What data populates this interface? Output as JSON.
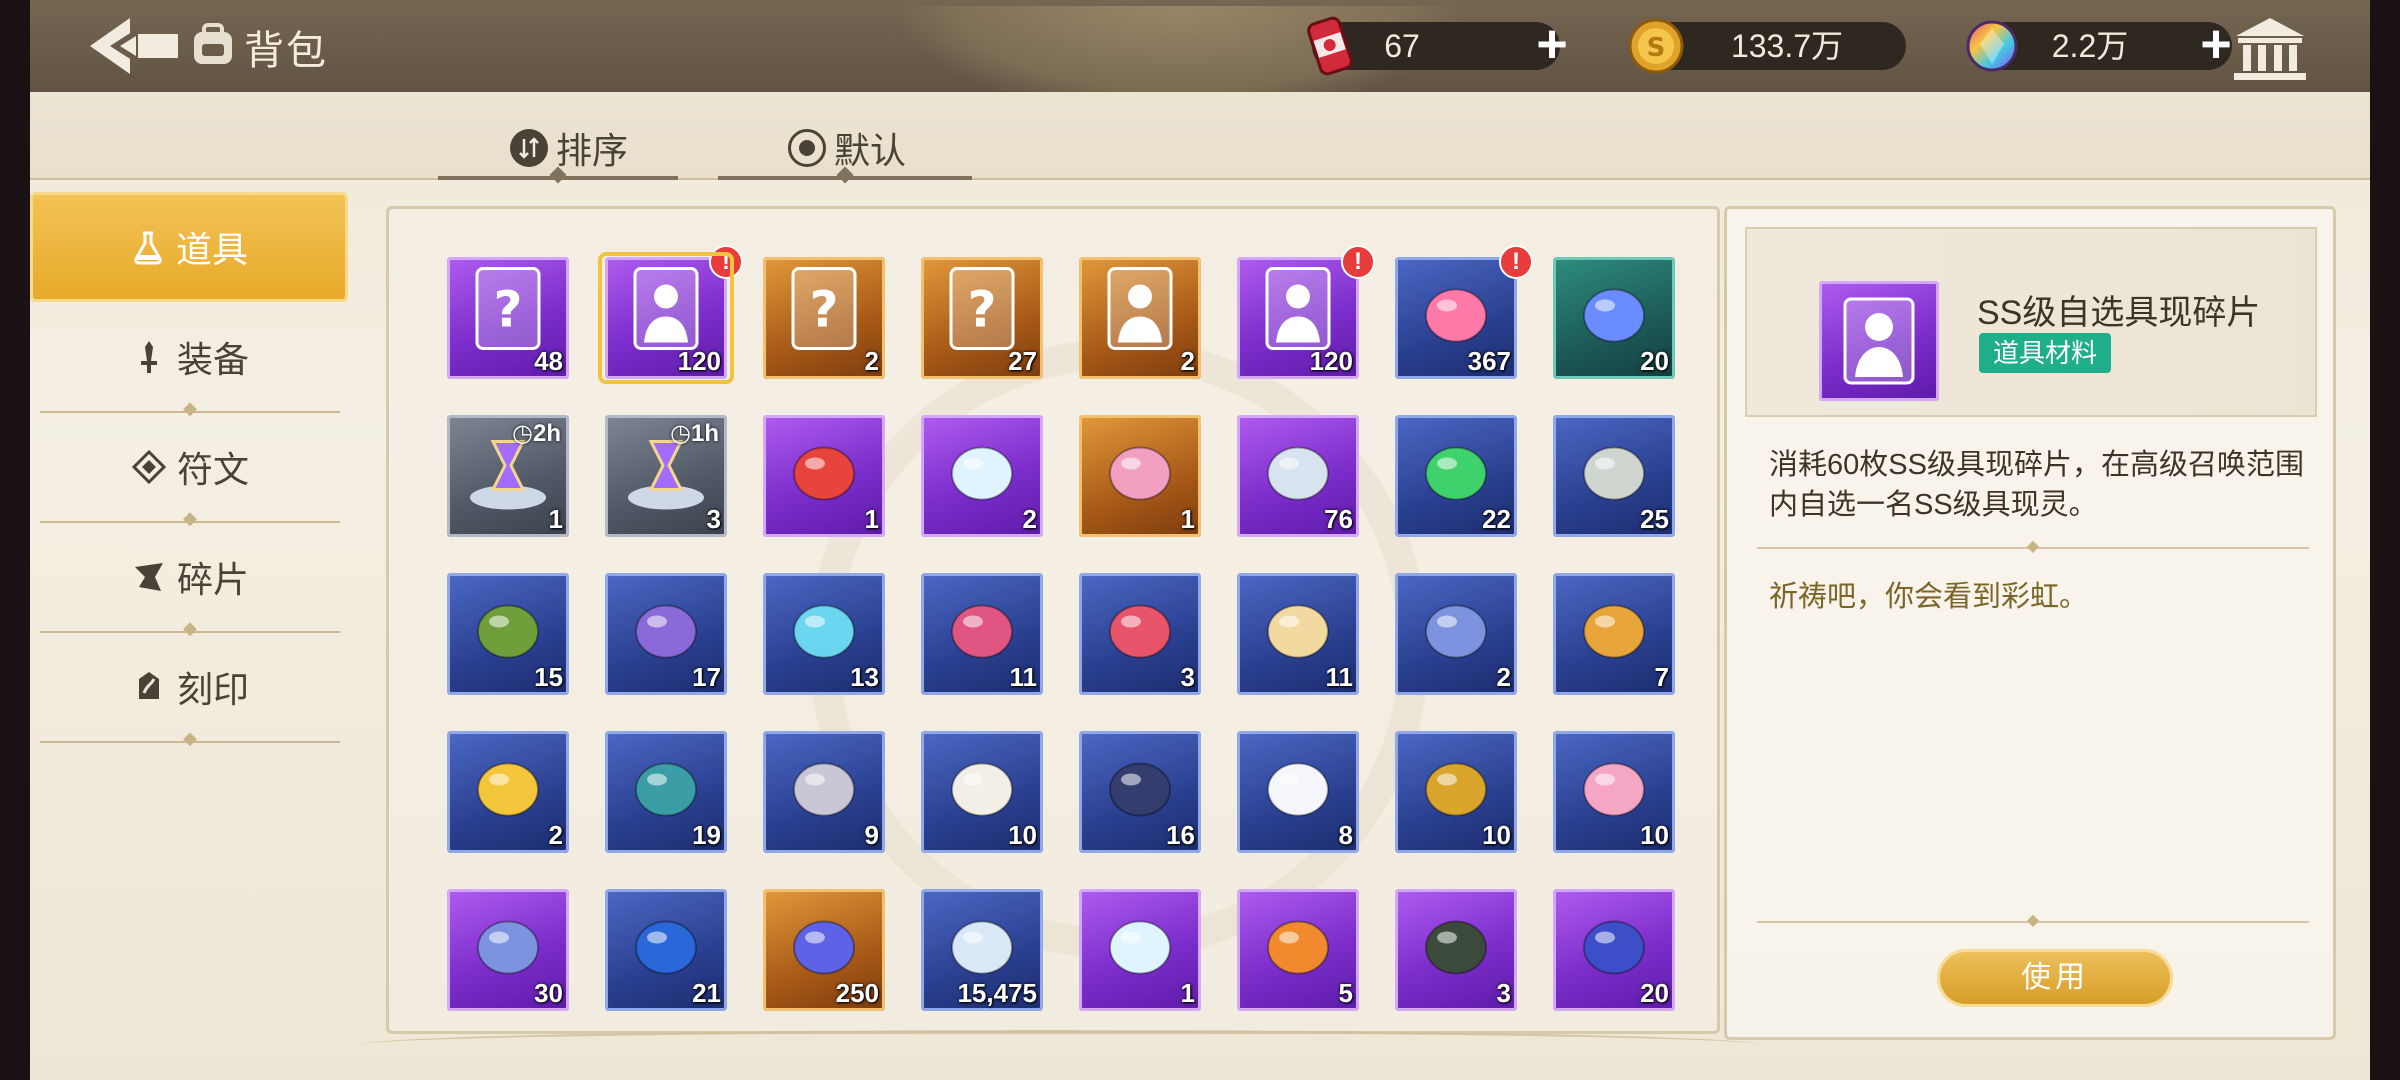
{
  "header": {
    "title": "背包",
    "resources": [
      {
        "name": "stamina",
        "icon": "energy-can-icon",
        "value": "67",
        "has_plus": true
      },
      {
        "name": "gold",
        "icon": "gold-coin-icon",
        "value": "133.7万",
        "has_plus": false
      },
      {
        "name": "crystal",
        "icon": "rainbow-crystal-icon",
        "value": "2.2万",
        "has_plus": true
      }
    ]
  },
  "sortbar": {
    "sort_label": "排序",
    "default_label": "默认"
  },
  "nav": {
    "items": [
      {
        "label": "道具",
        "icon": "flask-icon",
        "active": true
      },
      {
        "label": "装备",
        "icon": "sword-icon",
        "active": false
      },
      {
        "label": "符文",
        "icon": "rune-icon",
        "active": false
      },
      {
        "label": "碎片",
        "icon": "shard-icon",
        "active": false
      },
      {
        "label": "刻印",
        "icon": "seal-icon",
        "active": false
      }
    ]
  },
  "grid": {
    "rows": [
      [
        {
          "rarity": "purple",
          "icon": "mystery-card-icon",
          "count": "48"
        },
        {
          "rarity": "purple",
          "icon": "character-silhouette-card-icon",
          "count": "120",
          "badge": "!",
          "selected": true
        },
        {
          "rarity": "orange",
          "icon": "mystery-crystal-icon",
          "count": "2"
        },
        {
          "rarity": "orange",
          "icon": "mystery-card-icon",
          "count": "27"
        },
        {
          "rarity": "orange",
          "icon": "character-silhouette-card-icon",
          "count": "2"
        },
        {
          "rarity": "purple",
          "icon": "character-silhouette-card-icon",
          "count": "120",
          "badge": "!"
        },
        {
          "rarity": "blue",
          "icon": "gift-box-icon",
          "count": "367",
          "badge": "!"
        },
        {
          "rarity": "green",
          "icon": "gem-ring-icon",
          "count": "20"
        }
      ],
      [
        {
          "rarity": "grey",
          "icon": "hourglass-icon",
          "count": "1",
          "timer": "2h"
        },
        {
          "rarity": "grey",
          "icon": "hourglass-icon",
          "count": "3",
          "timer": "1h"
        },
        {
          "rarity": "purple",
          "icon": "flower-bouquet-icon",
          "count": "1"
        },
        {
          "rarity": "purple",
          "icon": "diamond-gem-icon",
          "count": "2"
        },
        {
          "rarity": "orange",
          "icon": "soap-bar-icon",
          "count": "1"
        },
        {
          "rarity": "purple",
          "icon": "robot-egg-icon",
          "count": "76"
        },
        {
          "rarity": "blue",
          "icon": "green-crystal-icon",
          "count": "22"
        },
        {
          "rarity": "blue",
          "icon": "grey-stone-icon",
          "count": "25"
        }
      ],
      [
        {
          "rarity": "blue",
          "icon": "leaf-icon",
          "count": "15"
        },
        {
          "rarity": "blue",
          "icon": "purple-ore-icon",
          "count": "17"
        },
        {
          "rarity": "blue",
          "icon": "water-bowl-icon",
          "count": "13"
        },
        {
          "rarity": "blue",
          "icon": "teapot-icon",
          "count": "11"
        },
        {
          "rarity": "blue",
          "icon": "potion-jar-icon",
          "count": "3"
        },
        {
          "rarity": "blue",
          "icon": "grain-pile-icon",
          "count": "11"
        },
        {
          "rarity": "blue",
          "icon": "blue-cloth-icon",
          "count": "2"
        },
        {
          "rarity": "blue",
          "icon": "bread-pile-icon",
          "count": "7"
        }
      ],
      [
        {
          "rarity": "blue",
          "icon": "golden-apple-icon",
          "count": "2"
        },
        {
          "rarity": "blue",
          "icon": "umbrella-icon",
          "count": "19"
        },
        {
          "rarity": "blue",
          "icon": "lighter-icon",
          "count": "9"
        },
        {
          "rarity": "blue",
          "icon": "open-book-icon",
          "count": "10"
        },
        {
          "rarity": "blue",
          "icon": "closed-book-icon",
          "count": "16"
        },
        {
          "rarity": "blue",
          "icon": "milk-carton-icon",
          "count": "8"
        },
        {
          "rarity": "blue",
          "icon": "medal-icon",
          "count": "10"
        },
        {
          "rarity": "blue",
          "icon": "pink-plush-icon",
          "count": "10"
        }
      ],
      [
        {
          "rarity": "purple",
          "icon": "blue-gem-icon",
          "count": "30"
        },
        {
          "rarity": "blue",
          "icon": "coin-chip-icon",
          "count": "21"
        },
        {
          "rarity": "orange",
          "icon": "sapphire-icon",
          "count": "250"
        },
        {
          "rarity": "blue",
          "icon": "ice-crystal-icon",
          "count": "15,475"
        },
        {
          "rarity": "purple",
          "icon": "diamond-ring-icon",
          "count": "1"
        },
        {
          "rarity": "purple",
          "icon": "cat-robot-icon",
          "count": "5"
        },
        {
          "rarity": "purple",
          "icon": "dagger-icon",
          "count": "3"
        },
        {
          "rarity": "purple",
          "icon": "fashion-tag-icon",
          "count": "20"
        }
      ]
    ]
  },
  "detail": {
    "name": "SS级自选具现碎片",
    "tag": "道具材料",
    "description": "消耗60枚SS级具现碎片，在高级召唤范围内自选一名SS级具现灵。",
    "flavor": "祈祷吧，你会看到彩虹。",
    "use_label": "使用"
  },
  "colors": {
    "accent_gold": "#e8a929",
    "rarity_purple": "#7c2ecb",
    "rarity_orange": "#a85a17",
    "rarity_blue": "#2a3f8f",
    "tag_green": "#1fae8a",
    "badge_red": "#e83b3b"
  }
}
